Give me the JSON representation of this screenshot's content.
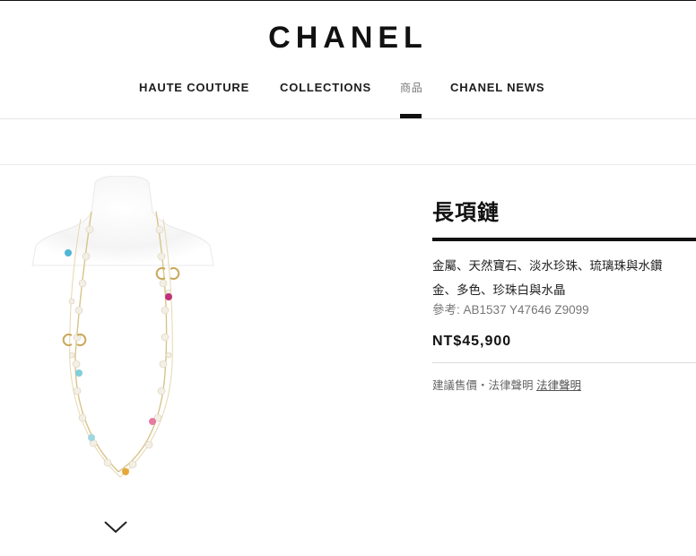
{
  "brand": {
    "logo_text": "CHANEL"
  },
  "nav": {
    "items": [
      {
        "label": "HAUTE COUTURE"
      },
      {
        "label": "COLLECTIONS"
      },
      {
        "label": "商品"
      },
      {
        "label": "CHANEL NEWS"
      }
    ],
    "active_index": 2
  },
  "product": {
    "title": "長項鏈",
    "description_line1": "金屬、天然寶石、淡水珍珠、琉璃珠與水鑽",
    "description_line2": "金、多色、珍珠白與水晶",
    "reference": "參考: AB1537 Y47646 Z9099",
    "price": "NT$45,900",
    "legal_prefix": "建議售價・法律聲明",
    "legal_link": "法律聲明",
    "image_icon": "necklace-on-bust"
  },
  "controls": {
    "scroll_icon": "chevron-down-icon"
  },
  "colors": {
    "text": "#1d1d1d",
    "muted": "#777777",
    "accent": "#111111"
  }
}
